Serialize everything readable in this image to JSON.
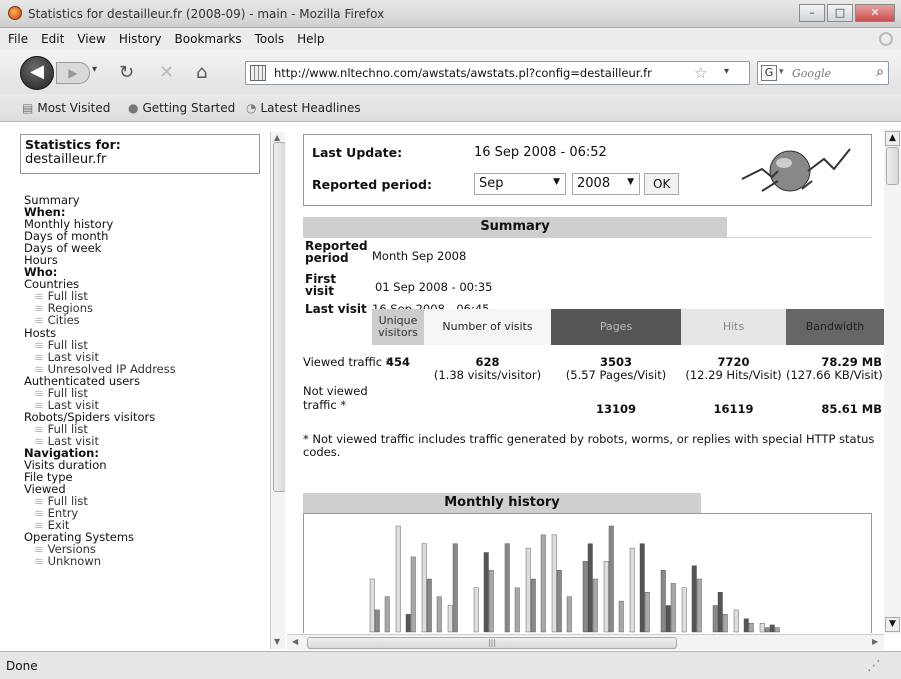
{
  "window": {
    "title": "Statistics for destailleur.fr (2008-09) - main - Mozilla Firefox",
    "buttons": [
      "–",
      "□",
      "✕"
    ]
  },
  "menu": [
    "File",
    "Edit",
    "View",
    "History",
    "Bookmarks",
    "Tools",
    "Help"
  ],
  "nav": {
    "url": "http://www.nltechno.com/awstats/awstats.pl?config=destailleur.fr",
    "search_placeholder": "Google",
    "search_engine_letter": "G"
  },
  "bookmarks": [
    {
      "label": "Most Visited",
      "icon": "bookmark-folder-icon"
    },
    {
      "label": "Getting Started",
      "icon": "firefox-icon"
    },
    {
      "label": "Latest Headlines",
      "icon": "rss-icon"
    }
  ],
  "sidebar": {
    "stats_for_label": "Statistics for:",
    "domain": "destailleur.fr",
    "items": [
      {
        "label": "Summary",
        "type": "link"
      },
      {
        "label": "When:",
        "type": "head"
      },
      {
        "label": "Monthly history",
        "type": "link"
      },
      {
        "label": "Days of month",
        "type": "link"
      },
      {
        "label": "Days of week",
        "type": "link"
      },
      {
        "label": "Hours",
        "type": "link"
      },
      {
        "label": "Who:",
        "type": "head"
      },
      {
        "label": "Countries",
        "type": "link"
      },
      {
        "label": "Full list",
        "type": "sub"
      },
      {
        "label": "Regions",
        "type": "sub"
      },
      {
        "label": "Cities",
        "type": "sub"
      },
      {
        "label": "Hosts",
        "type": "link"
      },
      {
        "label": "Full list",
        "type": "sub"
      },
      {
        "label": "Last visit",
        "type": "sub"
      },
      {
        "label": "Unresolved IP Address",
        "type": "sub"
      },
      {
        "label": "Authenticated users",
        "type": "link"
      },
      {
        "label": "Full list",
        "type": "sub"
      },
      {
        "label": "Last visit",
        "type": "sub"
      },
      {
        "label": "Robots/Spiders visitors",
        "type": "link"
      },
      {
        "label": "Full list",
        "type": "sub"
      },
      {
        "label": "Last visit",
        "type": "sub"
      },
      {
        "label": "Navigation:",
        "type": "head"
      },
      {
        "label": "Visits duration",
        "type": "link"
      },
      {
        "label": "File type",
        "type": "link"
      },
      {
        "label": "Viewed",
        "type": "link"
      },
      {
        "label": "Full list",
        "type": "sub"
      },
      {
        "label": "Entry",
        "type": "sub"
      },
      {
        "label": "Exit",
        "type": "sub"
      },
      {
        "label": "Operating Systems",
        "type": "link"
      },
      {
        "label": "Versions",
        "type": "sub"
      },
      {
        "label": "Unknown",
        "type": "sub"
      }
    ]
  },
  "main": {
    "last_update_label": "Last Update:",
    "last_update_value": "16 Sep 2008 - 06:52",
    "reported_period_label": "Reported period:",
    "month_select": "Sep",
    "year_select": "2008",
    "ok_label": "OK",
    "summary_title": "Summary",
    "rows": {
      "reported_period_label": "Reported period",
      "reported_period_value": "Month Sep 2008",
      "first_visit_label": "First visit",
      "first_visit_value": "01 Sep 2008 - 00:35",
      "last_visit_label": "Last visit",
      "last_visit_value": "16 Sep 2008 - 06:45"
    },
    "columns": [
      {
        "label": "Unique visitors",
        "bg": "#cccccc",
        "fg": "#333333"
      },
      {
        "label": "Number of visits",
        "bg": "#f5f5f5",
        "fg": "#222222"
      },
      {
        "label": "Pages",
        "bg": "#555555",
        "fg": "#bbbbbb"
      },
      {
        "label": "Hits",
        "bg": "#e6e6e6",
        "fg": "#888888"
      },
      {
        "label": "Bandwidth",
        "bg": "#666666",
        "fg": "#222222"
      }
    ],
    "viewed": {
      "label": "Viewed traffic *",
      "unique": "454",
      "visits": "628",
      "visits_sub": "(1.38 visits/visitor)",
      "pages": "3503",
      "pages_sub": "(5.57 Pages/Visit)",
      "hits": "7720",
      "hits_sub": "(12.29 Hits/Visit)",
      "bandwidth": "78.29 MB",
      "bandwidth_sub": "(127.66 KB/Visit)"
    },
    "not_viewed": {
      "label": "Not viewed traffic *",
      "pages": "13109",
      "hits": "16119",
      "bandwidth": "85.61 MB"
    },
    "note": "* Not viewed traffic includes traffic generated by robots, worms, or replies with special HTTP status codes.",
    "monthly_title": "Monthly history"
  },
  "chart_data": {
    "type": "bar",
    "title": "Monthly history",
    "series_colors": [
      "#dddddd",
      "#888888",
      "#555555",
      "#a8a8a8"
    ],
    "groups": [
      [
        60,
        25,
        0,
        40
      ],
      [
        120,
        0,
        20,
        85
      ],
      [
        100,
        60,
        0,
        40
      ],
      [
        30,
        100,
        0,
        0
      ],
      [
        50,
        0,
        90,
        70
      ],
      [
        0,
        100,
        0,
        50
      ],
      [
        95,
        60,
        0,
        110
      ],
      [
        110,
        70,
        0,
        40
      ],
      [
        0,
        80,
        100,
        60
      ],
      [
        80,
        120,
        0,
        35
      ],
      [
        95,
        0,
        100,
        45
      ],
      [
        0,
        70,
        30,
        55
      ],
      [
        50,
        0,
        75,
        60
      ],
      [
        0,
        30,
        45,
        20
      ],
      [
        25,
        0,
        15,
        10
      ],
      [
        10,
        5,
        8,
        5
      ]
    ]
  },
  "status": {
    "text": "Done"
  }
}
